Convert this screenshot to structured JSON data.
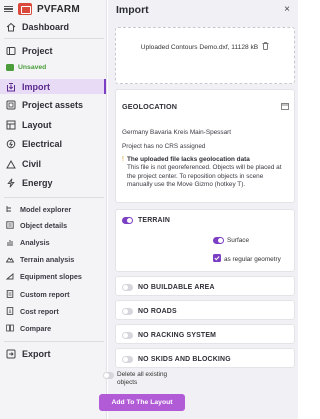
{
  "app": {
    "name": "PVFARM"
  },
  "sidebar": {
    "dashboard": "Dashboard",
    "project": "Project",
    "status": "Unsaved",
    "import": "Import",
    "project_assets": "Project assets",
    "layout": "Layout",
    "electrical": "Electrical",
    "civil": "Civil",
    "energy": "Energy",
    "model_explorer": "Model explorer",
    "object_details": "Object details",
    "analysis": "Analysis",
    "terrain_analysis": "Terrain analysis",
    "equipment_slopes": "Equipment slopes",
    "custom_report": "Custom report",
    "cost_report": "Cost report",
    "compare": "Compare",
    "export": "Export"
  },
  "panel": {
    "title": "Import",
    "close": "×",
    "file_name": "Uploaded Contours Demo.dxf, 11128 kB",
    "geolocation": {
      "title": "GEOLOCATION",
      "location": "Germany Bavaria Kreis Main-Spessart",
      "crs": "Project has no CRS assigned",
      "warning_title": "The uploaded file lacks geolocation data",
      "warning_text": "This file is not georeferenced. Objects will be placed at the project center. To reposition objects in scene manually use the Move Gizmo (hotkey T)."
    },
    "terrain": {
      "label": "TERRAIN",
      "enabled": true,
      "surface_label": "Surface",
      "surface_checked": false,
      "regular_label": "as regular geometry",
      "regular_checked": true
    },
    "sections": [
      {
        "label": "NO BUILDABLE AREA",
        "enabled": false
      },
      {
        "label": "NO ROADS",
        "enabled": false
      },
      {
        "label": "NO RACKING SYSTEM",
        "enabled": false
      },
      {
        "label": "NO SKIDS AND BLOCKING",
        "enabled": false
      }
    ],
    "delete_existing_label": "Delete all existing objects",
    "delete_existing_enabled": false,
    "add_button": "Add To The Layout"
  },
  "colors": {
    "accent": "#7b3fc4",
    "button": "#b15cd6",
    "success": "#4a9d3a",
    "warning": "#d99a1a"
  }
}
